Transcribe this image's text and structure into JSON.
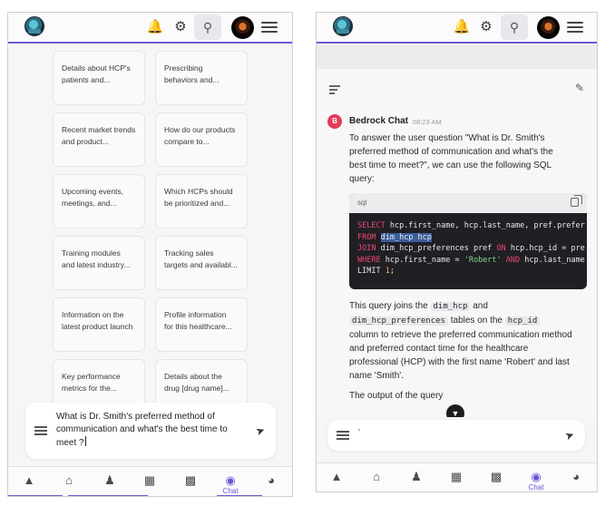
{
  "left_screen": {
    "prompt_cards": [
      {
        "line1": "Details about HCP's",
        "line2": "patients and..."
      },
      {
        "line1": "Prescribing",
        "line2": "behaviors and..."
      },
      {
        "line1": "Recent market trends",
        "line2": "and product..."
      },
      {
        "line1": "How do our products",
        "line2": "compare to..."
      },
      {
        "line1": "Upcoming events,",
        "line2": "meetings, and..."
      },
      {
        "line1": "Which HCPs should",
        "line2": "be prioritized and..."
      },
      {
        "line1": "Training modules",
        "line2": "and latest industry..."
      },
      {
        "line1": "Tracking sales",
        "line2": "targets and availabl..."
      },
      {
        "line1": "Information on the",
        "line2": "latest product launch"
      },
      {
        "line1": "Profile information",
        "line2": "for this healthcare..."
      },
      {
        "line1": "Key performance",
        "line2": "metrics for the..."
      },
      {
        "line1": "Details about the",
        "line2": "drug [drug name]..."
      }
    ],
    "composer": {
      "line1": "What is Dr. Smith's preferred method of",
      "line2": "communication and what's the best time to",
      "line3": "meet ?"
    }
  },
  "right_screen": {
    "bot": {
      "badge": "B",
      "name": "Bedrock Chat",
      "time": "08:23 AM"
    },
    "intro": {
      "l1": "To answer the user question \"What is Dr. Smith's",
      "l2": "preferred method of communication and what's the",
      "l3": "best time to meet?\", we can use the following SQL",
      "l4": "query:"
    },
    "code": {
      "lang": "sql",
      "line1_kw": "SELECT",
      "line1_rest": " hcp.first_name, hcp.last_name, pref.prefer",
      "line2_kw": "FROM",
      "line2_hl": "dim_hcp hcp",
      "line3_kw": "JOIN",
      "line3_a": " dim_hcp_preferences pref ",
      "line3_kw2": "ON",
      "line3_b": " hcp.hcp_id = pre",
      "line4_kw": "WHERE",
      "line4_a": " hcp.first_name = ",
      "line4_str": "'Robert'",
      "line4_kw2": " AND",
      "line4_b": " hcp.last_name",
      "line5_a": "LIMIT ",
      "line5_num": "1",
      "line5_b": ";"
    },
    "explain": {
      "p1": "This query joins the ",
      "code1": "dim_hcp",
      "p2": " and",
      "code2": "dim_hcp_preferences",
      "p3": " tables on the ",
      "code3": "hcp_id",
      "l3": "column to retrieve the preferred communication method",
      "l4": "and preferred contact time for the healthcare",
      "l5": "professional (HCP) with the first name 'Robert' and last",
      "l6": "name 'Smith'."
    },
    "output_text": "The output of the query",
    "composer_value": "'",
    "nav_chat_label": "Chat"
  },
  "nav_chat_label": "Chat",
  "colors": {
    "accent": "#6a5cd0",
    "bot_badge": "#e23b5a",
    "code_bg": "#1f1f24",
    "keyword": "#ef476f"
  },
  "icons": {
    "top_bar": [
      "app-logo",
      "bell-icon",
      "gear-icon",
      "search-icon",
      "avatar",
      "menu-icon"
    ],
    "bottom_nav": [
      "navigate-arrow-icon",
      "home-icon",
      "contacts-icon",
      "calendar-icon",
      "dashboard-icon",
      "chat-icon",
      "support-icon"
    ]
  }
}
